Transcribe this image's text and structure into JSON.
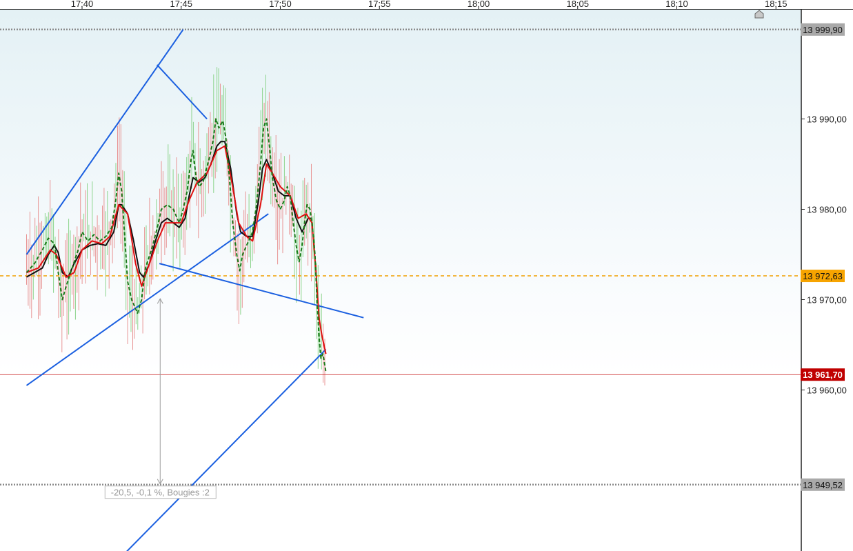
{
  "chart_data": {
    "type": "candlestick",
    "x_ticks": [
      "17:40",
      "17:45",
      "17:50",
      "17:55",
      "18:00",
      "18:05",
      "18:10",
      "18:15"
    ],
    "y_ticks": [
      "13 990,00",
      "13 980,00",
      "13 970,00",
      "13 960,00"
    ],
    "y_range": [
      13950,
      14000
    ],
    "price_tags": [
      {
        "label": "13 999,90",
        "value": 13999.9,
        "style": "grey"
      },
      {
        "label": "13 972,63",
        "value": 13972.63,
        "style": "orange"
      },
      {
        "label": "13 961,70",
        "value": 13961.7,
        "style": "red"
      },
      {
        "label": "13 949,52",
        "value": 13949.52,
        "style": "grey"
      }
    ],
    "measure_label": "-20,5, -0,1 %, Bougies :2",
    "series": [
      {
        "kind": "ma-fast",
        "color": "#1a7a1a",
        "dashed": true,
        "points": [
          [
            -2.8,
            13973.0
          ],
          [
            -2.4,
            13974.0
          ],
          [
            -2.0,
            13975.5
          ],
          [
            -1.7,
            13976.8
          ],
          [
            -1.4,
            13976.2
          ],
          [
            -1.2,
            13973.0
          ],
          [
            -1.0,
            13970.0
          ],
          [
            -0.8,
            13971.5
          ],
          [
            -0.5,
            13973.5
          ],
          [
            -0.2,
            13975.5
          ],
          [
            0.0,
            13977.5
          ],
          [
            0.3,
            13976.5
          ],
          [
            0.6,
            13977.2
          ],
          [
            0.9,
            13976.5
          ],
          [
            1.2,
            13977.0
          ],
          [
            1.5,
            13978.0
          ],
          [
            1.7,
            13981.0
          ],
          [
            1.85,
            13984.0
          ],
          [
            2.0,
            13982.0
          ],
          [
            2.15,
            13977.0
          ],
          [
            2.3,
            13972.0
          ],
          [
            2.5,
            13970.0
          ],
          [
            2.8,
            13968.5
          ],
          [
            3.0,
            13970.0
          ],
          [
            3.2,
            13973.5
          ],
          [
            3.5,
            13975.5
          ],
          [
            3.8,
            13978.0
          ],
          [
            4.0,
            13980.0
          ],
          [
            4.3,
            13980.5
          ],
          [
            4.6,
            13980.0
          ],
          [
            4.9,
            13978.5
          ],
          [
            5.1,
            13980.0
          ],
          [
            5.3,
            13982.0
          ],
          [
            5.5,
            13985.5
          ],
          [
            5.6,
            13986.5
          ],
          [
            5.75,
            13983.5
          ],
          [
            5.9,
            13982.5
          ],
          [
            6.1,
            13983.0
          ],
          [
            6.4,
            13985.5
          ],
          [
            6.6,
            13987.5
          ],
          [
            6.75,
            13990.0
          ],
          [
            6.9,
            13989.0
          ],
          [
            7.1,
            13989.8
          ],
          [
            7.25,
            13988.0
          ],
          [
            7.45,
            13983.0
          ],
          [
            7.6,
            13978.5
          ],
          [
            7.8,
            13975.0
          ],
          [
            7.95,
            13973.2
          ],
          [
            8.1,
            13975.0
          ],
          [
            8.4,
            13976.5
          ],
          [
            8.6,
            13977.5
          ],
          [
            8.8,
            13980.5
          ],
          [
            9.0,
            13985.0
          ],
          [
            9.15,
            13989.0
          ],
          [
            9.3,
            13990.0
          ],
          [
            9.45,
            13987.0
          ],
          [
            9.6,
            13983.5
          ],
          [
            9.8,
            13981.0
          ],
          [
            10.0,
            13980.0
          ],
          [
            10.2,
            13981.0
          ],
          [
            10.35,
            13982.5
          ],
          [
            10.5,
            13981.5
          ],
          [
            10.65,
            13978.5
          ],
          [
            10.8,
            13976.0
          ],
          [
            10.95,
            13974.2
          ],
          [
            11.1,
            13976.0
          ],
          [
            11.25,
            13979.0
          ],
          [
            11.35,
            13980.5
          ],
          [
            11.5,
            13980.0
          ],
          [
            11.6,
            13978.5
          ],
          [
            11.75,
            13975.0
          ],
          [
            11.85,
            13970.0
          ],
          [
            11.95,
            13966.0
          ],
          [
            12.05,
            13963.5
          ],
          [
            12.15,
            13964.0
          ],
          [
            12.3,
            13962.0
          ]
        ]
      },
      {
        "kind": "ma-mid",
        "color": "#111111",
        "dashed": false,
        "points": [
          [
            -2.8,
            13972.5
          ],
          [
            -2.4,
            13973.0
          ],
          [
            -2.0,
            13973.5
          ],
          [
            -1.7,
            13975.0
          ],
          [
            -1.4,
            13976.0
          ],
          [
            -1.2,
            13975.2
          ],
          [
            -1.0,
            13973.0
          ],
          [
            -0.7,
            13972.5
          ],
          [
            -0.4,
            13974.0
          ],
          [
            0.0,
            13975.5
          ],
          [
            0.4,
            13976.0
          ],
          [
            0.8,
            13976.2
          ],
          [
            1.2,
            13976.0
          ],
          [
            1.6,
            13977.5
          ],
          [
            1.85,
            13980.5
          ],
          [
            2.0,
            13980.5
          ],
          [
            2.3,
            13979.5
          ],
          [
            2.6,
            13976.5
          ],
          [
            2.9,
            13973.0
          ],
          [
            3.1,
            13972.5
          ],
          [
            3.4,
            13974.0
          ],
          [
            3.7,
            13976.5
          ],
          [
            4.0,
            13978.5
          ],
          [
            4.3,
            13979.0
          ],
          [
            4.6,
            13978.5
          ],
          [
            4.9,
            13978.0
          ],
          [
            5.2,
            13979.0
          ],
          [
            5.4,
            13981.5
          ],
          [
            5.6,
            13983.5
          ],
          [
            5.9,
            13983.0
          ],
          [
            6.2,
            13983.5
          ],
          [
            6.5,
            13985.0
          ],
          [
            6.8,
            13987.0
          ],
          [
            7.0,
            13987.5
          ],
          [
            7.2,
            13987.5
          ],
          [
            7.5,
            13984.5
          ],
          [
            7.8,
            13979.5
          ],
          [
            8.0,
            13977.5
          ],
          [
            8.3,
            13977.0
          ],
          [
            8.6,
            13977.0
          ],
          [
            8.9,
            13981.0
          ],
          [
            9.1,
            13984.5
          ],
          [
            9.3,
            13985.5
          ],
          [
            9.6,
            13984.0
          ],
          [
            9.9,
            13982.0
          ],
          [
            10.2,
            13981.5
          ],
          [
            10.5,
            13981.5
          ],
          [
            10.8,
            13979.0
          ],
          [
            11.1,
            13977.5
          ],
          [
            11.4,
            13979.0
          ],
          [
            11.6,
            13979.0
          ]
        ]
      },
      {
        "kind": "ma-slow",
        "color": "#e01010",
        "dashed": false,
        "points": [
          [
            -2.8,
            13973.0
          ],
          [
            -2.2,
            13973.5
          ],
          [
            -1.6,
            13975.5
          ],
          [
            -1.3,
            13975.0
          ],
          [
            -0.8,
            13972.5
          ],
          [
            -0.4,
            13973.0
          ],
          [
            0.0,
            13975.5
          ],
          [
            0.5,
            13976.5
          ],
          [
            1.0,
            13976.2
          ],
          [
            1.4,
            13977.0
          ],
          [
            1.85,
            13980.5
          ],
          [
            2.3,
            13979.5
          ],
          [
            2.7,
            13974.0
          ],
          [
            3.0,
            13971.5
          ],
          [
            3.4,
            13974.0
          ],
          [
            3.8,
            13976.5
          ],
          [
            4.2,
            13978.5
          ],
          [
            4.6,
            13978.5
          ],
          [
            5.0,
            13978.5
          ],
          [
            5.4,
            13981.0
          ],
          [
            5.8,
            13983.0
          ],
          [
            6.3,
            13984.0
          ],
          [
            6.8,
            13986.5
          ],
          [
            7.2,
            13987.0
          ],
          [
            7.6,
            13982.5
          ],
          [
            7.9,
            13978.5
          ],
          [
            8.3,
            13977.0
          ],
          [
            8.6,
            13976.5
          ],
          [
            9.0,
            13980.5
          ],
          [
            9.3,
            13985.0
          ],
          [
            9.6,
            13984.0
          ],
          [
            10.0,
            13982.5
          ],
          [
            10.5,
            13981.5
          ],
          [
            10.9,
            13979.0
          ],
          [
            11.3,
            13979.5
          ],
          [
            11.6,
            13978.5
          ],
          [
            11.8,
            13973.0
          ],
          [
            11.95,
            13968.0
          ],
          [
            12.1,
            13966.0
          ],
          [
            12.3,
            13964.0
          ]
        ]
      }
    ],
    "trendlines": [
      {
        "from": [
          -2.8,
          13975.0
        ],
        "to": [
          5.1,
          13999.9
        ]
      },
      {
        "from": [
          -2.8,
          13960.5
        ],
        "to": [
          9.4,
          13979.5
        ]
      },
      {
        "from": [
          1.3,
          13940.0
        ],
        "to": [
          12.3,
          13964.5
        ]
      },
      {
        "from": [
          3.78,
          13996.0
        ],
        "to": [
          6.3,
          13990.0
        ]
      },
      {
        "from": [
          3.9,
          13974.0
        ],
        "to": [
          14.2,
          13968.0
        ]
      }
    ],
    "measure": {
      "x": 3.94,
      "from": 13970.1,
      "to": 13949.6
    }
  },
  "marker_icon": "house-icon"
}
